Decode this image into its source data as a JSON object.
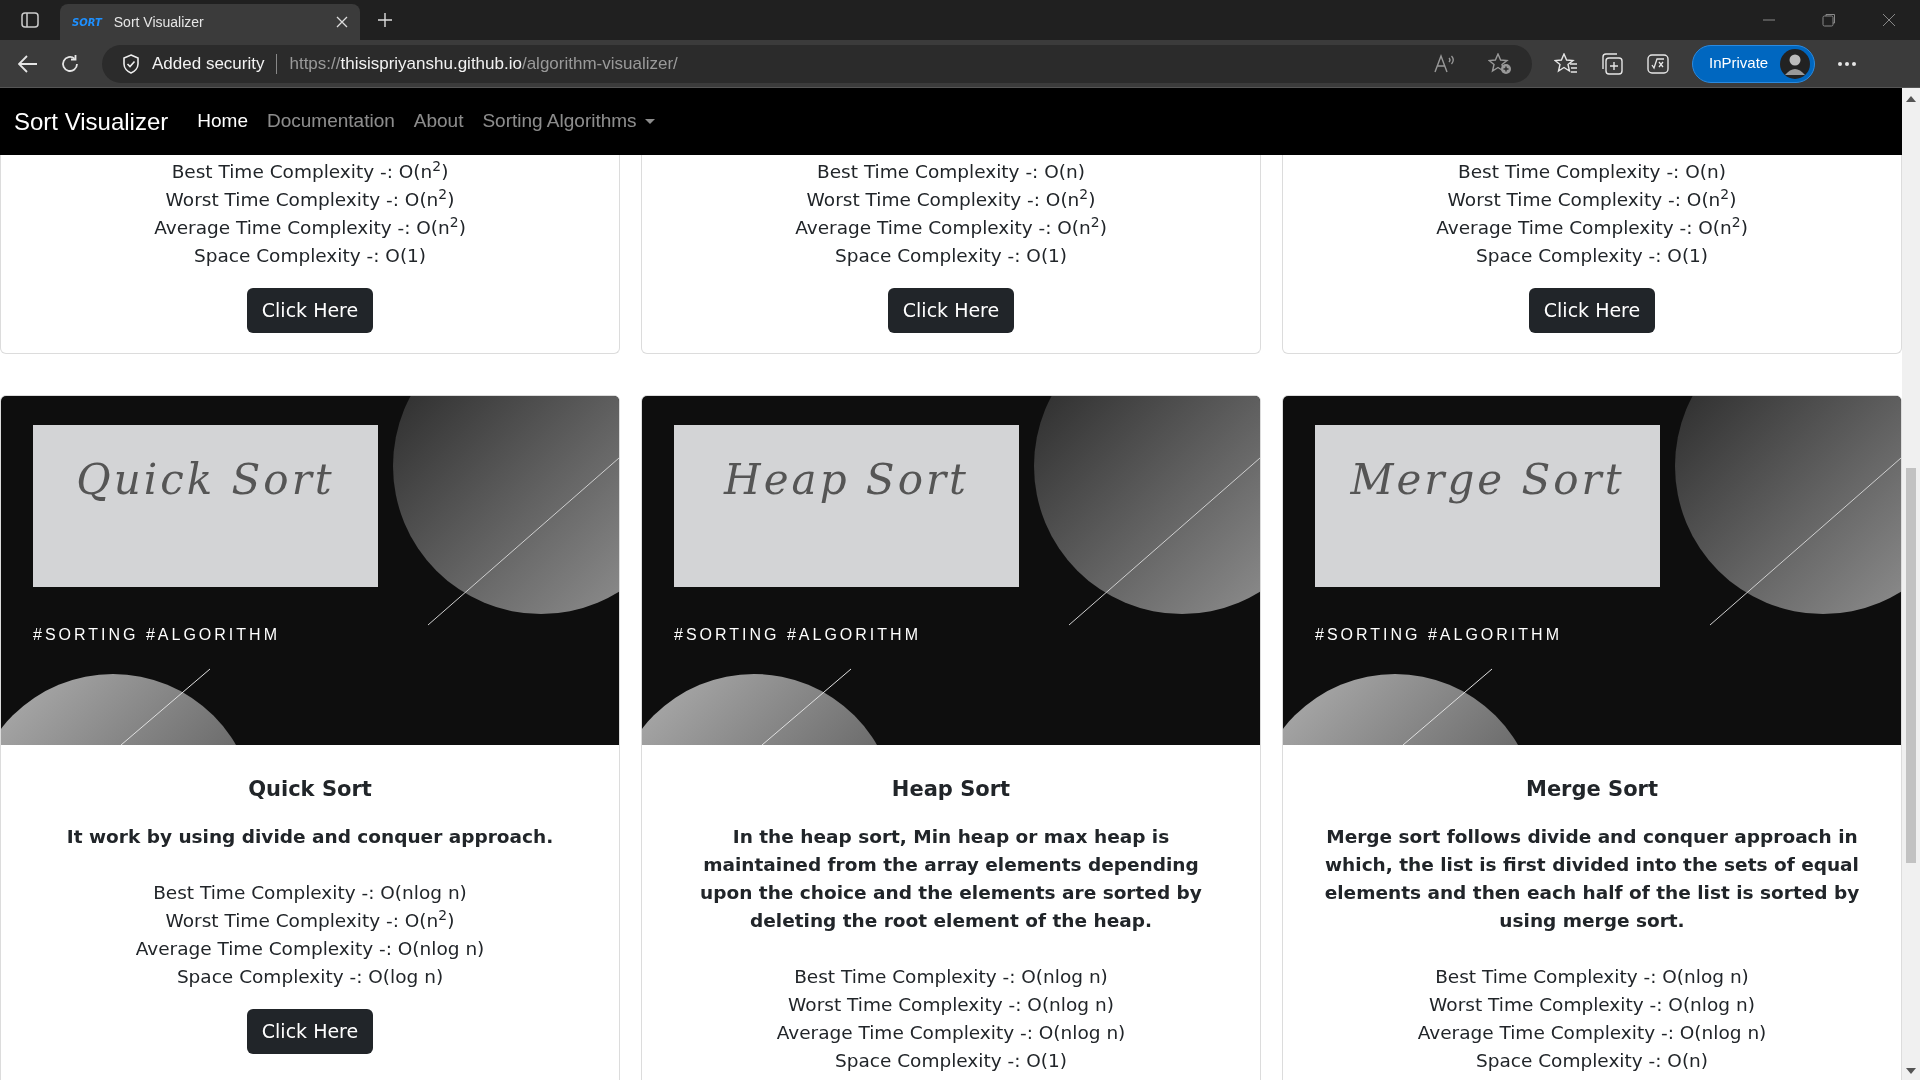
{
  "browser": {
    "tab_title": "Sort Visualizer",
    "tab_favicon_text": "SORT",
    "security_label": "Added security",
    "url_scheme": "https://",
    "url_host": "thisispriyanshu.github.io",
    "url_path": "/algorithm-visualizer/",
    "profile_label": "InPrivate"
  },
  "navbar": {
    "brand": "Sort Visualizer",
    "links": [
      {
        "label": "Home",
        "selected": true
      },
      {
        "label": "Documentation",
        "selected": false
      },
      {
        "label": "About",
        "selected": false
      },
      {
        "label": "Sorting Algorithms",
        "selected": false,
        "kind": "dropdown"
      }
    ]
  },
  "top_cards": [
    {
      "lines": [
        "Best Time Complexity -: O(n$^{2}$)",
        "Worst Time Complexity -: O(n$^{2}$)",
        "Average Time Complexity -: O(n$^{2}$)",
        "Space Complexity -: O(1)"
      ],
      "button": "Click Here"
    },
    {
      "lines": [
        "Best Time Complexity -: O(n)",
        "Worst Time Complexity -: O(n$^{2}$)",
        "Average Time Complexity -: O(n$^{2}$)",
        "Space Complexity -: O(1)"
      ],
      "button": "Click Here"
    },
    {
      "lines": [
        "Best Time Complexity -: O(n)",
        "Worst Time Complexity -: O(n$^{2}$)",
        "Average Time Complexity -: O(n$^{2}$)",
        "Space Complexity -: O(1)"
      ],
      "button": "Click Here"
    }
  ],
  "cards": [
    {
      "image_title": "Quick Sort",
      "image_tags": "#SORTING #ALGORITHM",
      "title": "Quick Sort",
      "description": "It work by using divide and conquer approach.",
      "lines": [
        "Best Time Complexity -: O(nlog n)",
        "Worst Time Complexity -: O(n$^{2}$)",
        "Average Time Complexity -: O(nlog n)",
        "Space Complexity -: O(log n)"
      ],
      "button": "Click Here"
    },
    {
      "image_title": "Heap Sort",
      "image_tags": "#SORTING #ALGORITHM",
      "title": "Heap Sort",
      "description": "In the heap sort, Min heap or max heap is maintained from the array elements depending upon the choice and the elements are sorted by deleting the root element of the heap.",
      "lines": [
        "Best Time Complexity -: O(nlog n)",
        "Worst Time Complexity -: O(nlog n)",
        "Average Time Complexity -: O(nlog n)",
        "Space Complexity -: O(1)"
      ]
    },
    {
      "image_title": "Merge Sort",
      "image_tags": "#SORTING #ALGORITHM",
      "title": "Merge Sort",
      "description": "Merge sort follows divide and conquer approach in which, the list is first divided into the sets of equal elements and then each half of the list is sorted by using merge sort.",
      "lines": [
        "Best Time Complexity -: O(nlog n)",
        "Worst Time Complexity -: O(nlog n)",
        "Average Time Complexity -: O(nlog n)",
        "Space Complexity -: O(n)"
      ]
    }
  ]
}
